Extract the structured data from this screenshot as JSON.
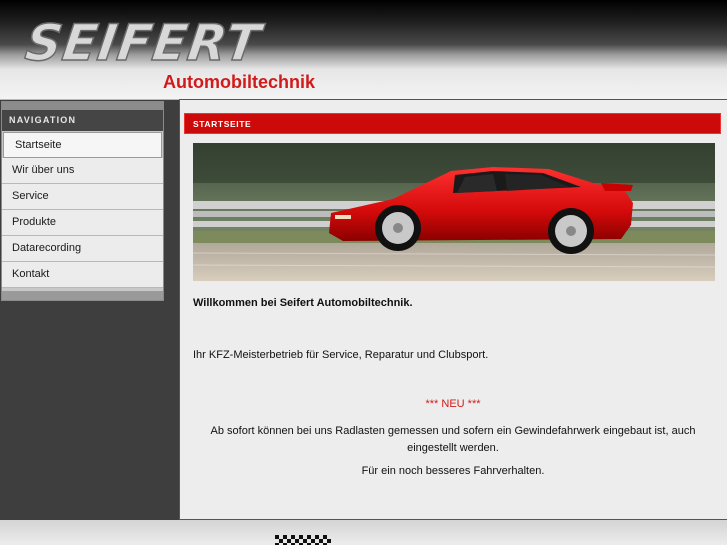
{
  "header": {
    "logo_text": "SEIFERT",
    "subtitle": "Automobiltechnik"
  },
  "navigation": {
    "title": "NAVIGATION",
    "items": [
      {
        "label": "Startseite",
        "active": true
      },
      {
        "label": "Wir über uns",
        "active": false
      },
      {
        "label": "Service",
        "active": false
      },
      {
        "label": "Produkte",
        "active": false
      },
      {
        "label": "Datarecording",
        "active": false
      },
      {
        "label": "Kontakt",
        "active": false
      }
    ]
  },
  "content": {
    "section_title": "STARTSEITE",
    "welcome": "Willkommen bei Seifert Automobiltechnik.",
    "intro": "Ihr KFZ-Meisterbetrieb für Service, Reparatur und Clubsport.",
    "news_label": "*** NEU ***",
    "news_line1": "Ab sofort können bei uns Radlasten gemessen und sofern ein Gewindefahrwerk eingebaut ist, auch",
    "news_line2": "eingestellt werden.",
    "news_line3": "Für ein noch besseres Fahrverhalten."
  },
  "colors": {
    "brand_red": "#cc0a0a",
    "nav_dark": "#454545",
    "content_bg": "#ededed"
  }
}
